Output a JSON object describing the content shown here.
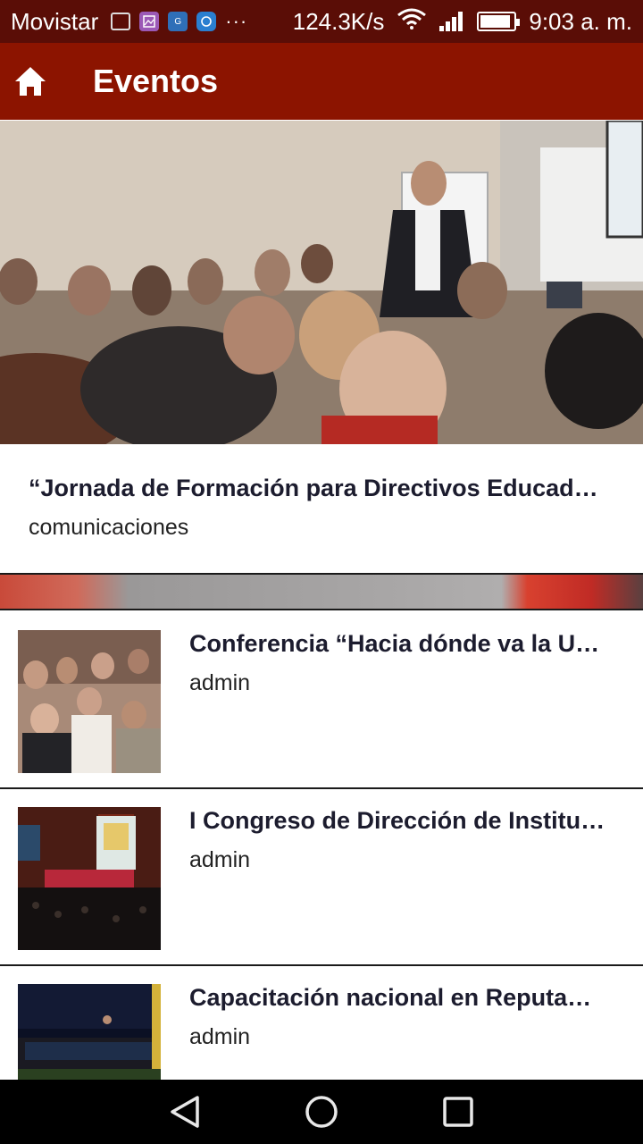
{
  "status_bar": {
    "carrier": "Movistar",
    "notification_icons": [
      "bbm-icon",
      "gallery-icon",
      "translate-icon",
      "app-circle-icon"
    ],
    "more": "···",
    "speed": "124.3K/s",
    "time": "9:03 a. m.",
    "battery_level": 0.9
  },
  "app_bar": {
    "title": "Eventos",
    "color": "#8c1400",
    "home_icon": "home-icon"
  },
  "featured": {
    "title": "“Jornada de Formación para Directivos Educad…",
    "author": "comunicaciones"
  },
  "items": [
    {
      "title": "Conferencia “Hacia dónde va la U…",
      "author": "admin"
    },
    {
      "title": "I Congreso de Dirección de Institu…",
      "author": "admin"
    },
    {
      "title": "Capacitación nacional en Reputa…",
      "author": "admin"
    }
  ],
  "nav_bar": {
    "back_icon": "back-triangle-icon",
    "home_icon": "home-circle-icon",
    "recents_icon": "recents-square-icon"
  }
}
